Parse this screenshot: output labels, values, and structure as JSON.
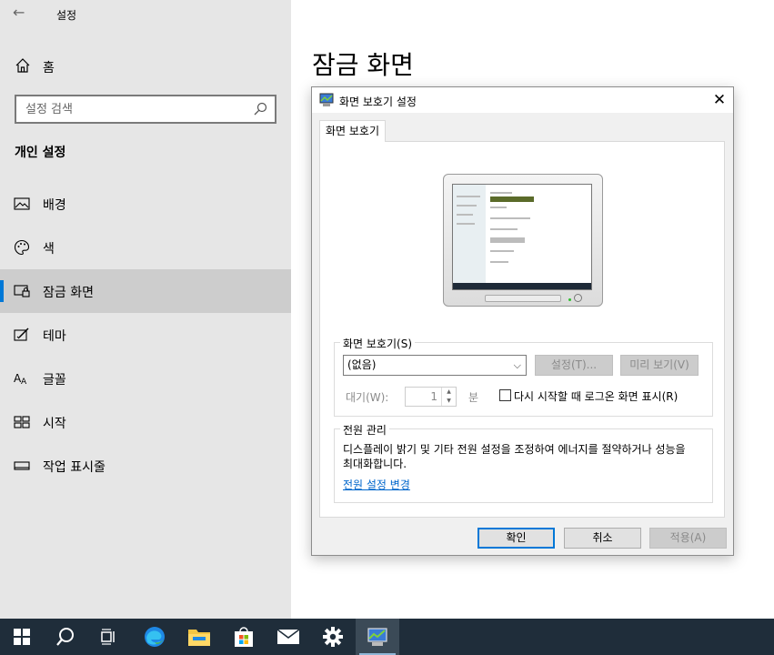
{
  "settings": {
    "app_title": "설정",
    "home_label": "홈",
    "search_placeholder": "설정 검색",
    "section_title": "개인 설정",
    "nav": [
      {
        "label": "배경",
        "icon": "picture-icon"
      },
      {
        "label": "색",
        "icon": "palette-icon"
      },
      {
        "label": "잠금 화면",
        "icon": "lock-screen-icon",
        "selected": true
      },
      {
        "label": "테마",
        "icon": "theme-icon"
      },
      {
        "label": "글꼴",
        "icon": "font-icon"
      },
      {
        "label": "시작",
        "icon": "start-icon"
      },
      {
        "label": "작업 표시줄",
        "icon": "taskbar-icon"
      }
    ],
    "page_heading": "잠금 화면",
    "accent_color": "#0078d7"
  },
  "dialog": {
    "title": "화면 보호기 설정",
    "tab_label": "화면 보호기",
    "screensaver_group_label": "화면 보호기(S)",
    "screensaver_selected": "(없음)",
    "settings_button": "설정(T)...",
    "preview_button": "미리 보기(V)",
    "wait_label": "대기(W):",
    "wait_value": "1",
    "wait_unit": "분",
    "resume_logon_label": "다시 시작할 때 로그온 화면 표시(R)",
    "resume_logon_checked": false,
    "power_group_label": "전원 관리",
    "power_text": "디스플레이 밝기 및 기타 전원 설정을 조정하여 에너지를 절약하거나 성능을 최대화합니다.",
    "power_link": "전원 설정 변경",
    "ok_button": "확인",
    "cancel_button": "취소",
    "apply_button": "적용(A)"
  },
  "taskbar": {
    "items": [
      "start-icon",
      "search-icon",
      "task-view-icon",
      "edge-icon",
      "file-explorer-icon",
      "store-icon",
      "mail-icon",
      "settings-icon",
      "screensaver-app-icon"
    ]
  }
}
